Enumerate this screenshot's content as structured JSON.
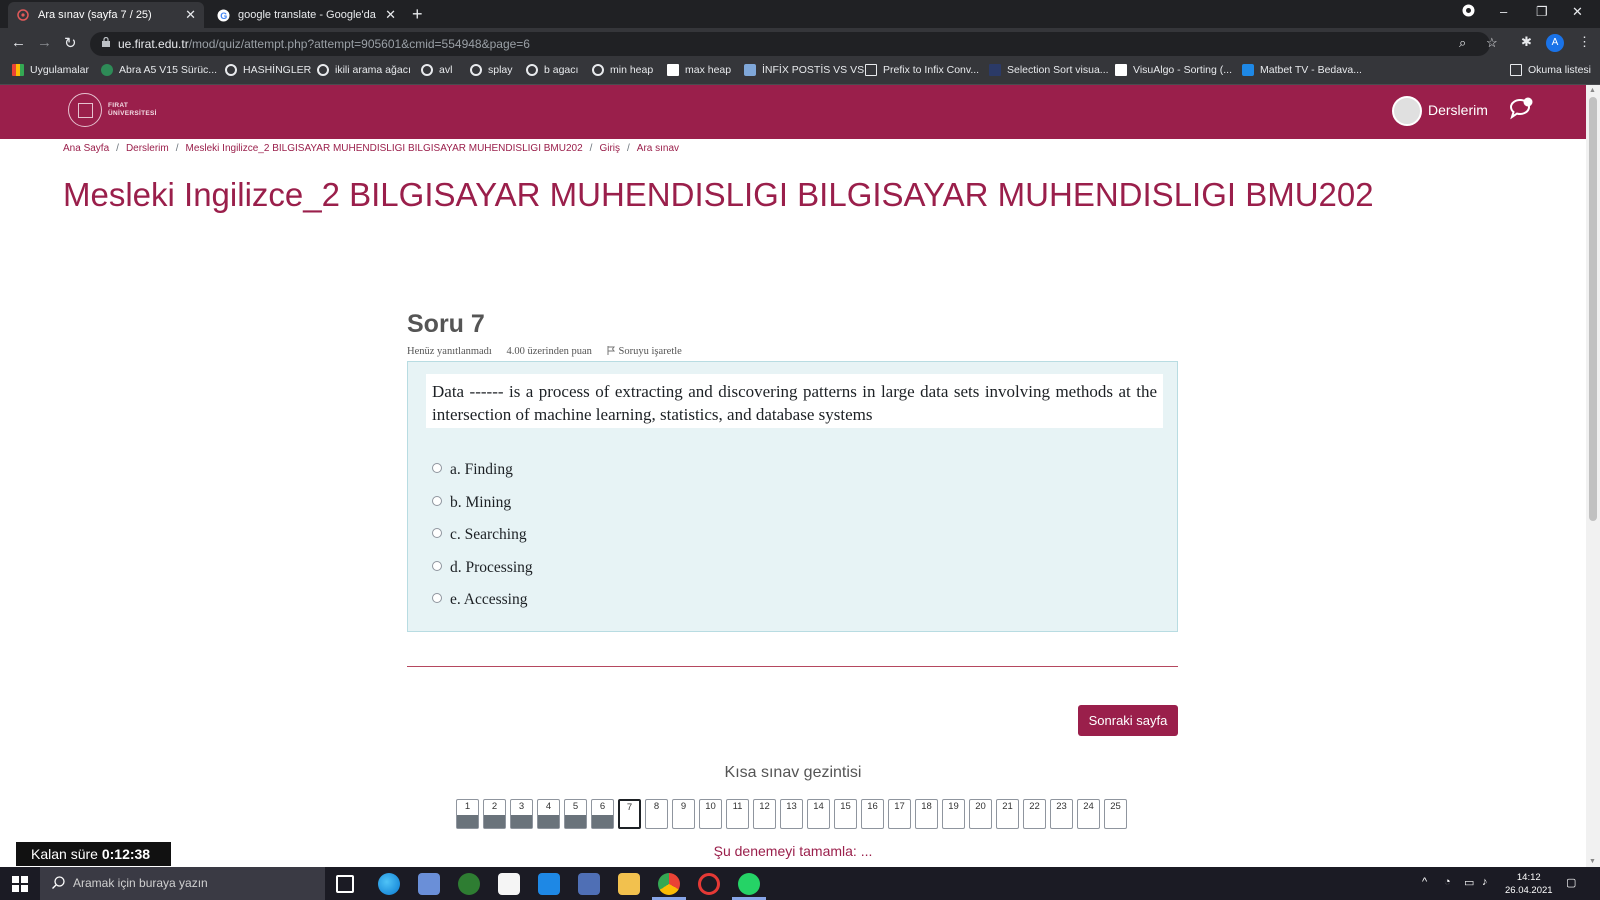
{
  "browser": {
    "tabs": [
      {
        "title": "Ara sınav (sayfa 7 / 25)",
        "active": true,
        "icon": "moodle-favicon"
      },
      {
        "title": "google translate - Google'da Ara",
        "active": false,
        "icon": "google-favicon"
      }
    ],
    "new_tab": "+",
    "url_host": "ue.firat.edu.tr",
    "url_path": "/mod/quiz/attempt.php?attempt=905601&cmid=554948&page=6",
    "profile_initial": "A",
    "bookmarks": [
      {
        "label": "Uygulamalar",
        "icon": "apps-grid-icon"
      },
      {
        "label": "Abra A5 V15 Sürüc...",
        "icon": "abra-icon"
      },
      {
        "label": "HASHİNGLER",
        "icon": "globe-icon"
      },
      {
        "label": "ikili arama ağacı",
        "icon": "globe-icon"
      },
      {
        "label": "avl",
        "icon": "globe-icon"
      },
      {
        "label": "splay",
        "icon": "globe-icon"
      },
      {
        "label": "b agacı",
        "icon": "globe-icon"
      },
      {
        "label": "min heap",
        "icon": "globe-icon"
      },
      {
        "label": "max heap",
        "icon": "visualgo-icon"
      },
      {
        "label": "İNFİX POSTİS VS VS",
        "icon": "cube-icon"
      },
      {
        "label": "Prefix to Infix Conv...",
        "icon": "calc-icon"
      },
      {
        "label": "Selection Sort visua...",
        "icon": "blank-icon"
      },
      {
        "label": "VisuAlgo - Sorting (...",
        "icon": "visualgo-icon"
      },
      {
        "label": "Matbet TV - Bedava...",
        "icon": "tv-icon"
      }
    ],
    "reading_list": "Okuma listesi"
  },
  "site": {
    "logo_line1": "FIRAT",
    "logo_line2": "ÜNİVERSİTESİ",
    "user_menu_label": "Derslerim"
  },
  "breadcrumb": [
    "Ana Sayfa",
    "Derslerim",
    "Mesleki Ingilizce_2 BILGISAYAR MUHENDISLIGI BILGISAYAR MUHENDISLIGI BMU202",
    "Giriş",
    "Ara sınav"
  ],
  "page_title": "Mesleki Ingilizce_2 BILGISAYAR MUHENDISLIGI BILGISAYAR MUHENDISLIGI BMU202",
  "question": {
    "title": "Soru 7",
    "status": "Henüz yanıtlanmadı",
    "points": "4.00 üzerinden puan",
    "flag_label": "Soruyu işaretle",
    "text": "Data ------ is a process of extracting and discovering patterns in large data sets involving methods at the intersection of machine learning, statistics, and database systems",
    "answers": [
      "a. Finding",
      "b. Mining",
      "c. Searching",
      "d. Processing",
      "e. Accessing"
    ]
  },
  "next_button": "Sonraki sayfa",
  "quiz_nav": {
    "title": "Kısa sınav gezintisi",
    "current": 7,
    "answered": [
      1,
      2,
      3,
      4,
      5,
      6
    ],
    "pages": [
      "1",
      "2",
      "3",
      "4",
      "5",
      "6",
      "7",
      "8",
      "9",
      "10",
      "11",
      "12",
      "13",
      "14",
      "15",
      "16",
      "17",
      "18",
      "19",
      "20",
      "21",
      "22",
      "23",
      "24",
      "25"
    ]
  },
  "finish_link": "Şu denemeyi tamamla: ...",
  "timer": {
    "label": "Kalan süre",
    "value": "0:12:38"
  },
  "taskbar": {
    "search_placeholder": "Aramak için buraya yazın",
    "time": "14:12",
    "date": "26.04.2021"
  },
  "colors": {
    "brand": "#9a1f4b",
    "question_bg": "#e7f3f5"
  }
}
